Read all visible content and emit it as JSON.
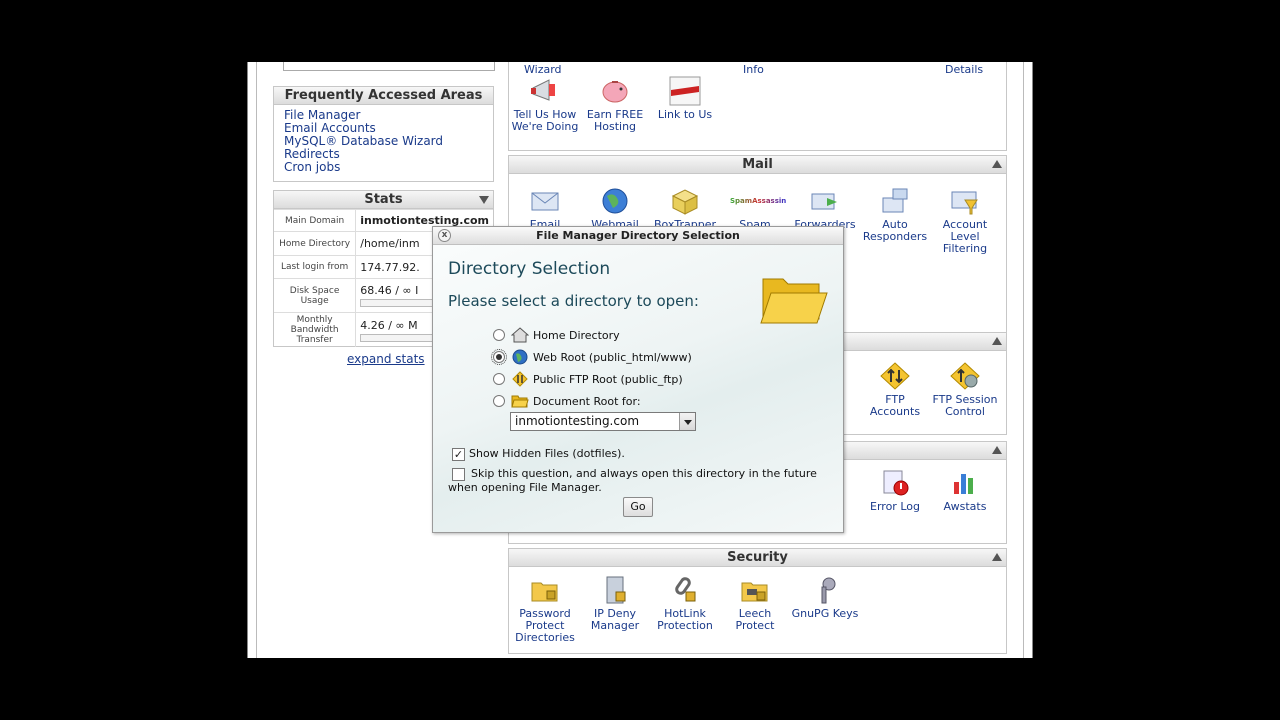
{
  "left": {
    "faa": {
      "title": "Frequently Accessed Areas",
      "links": [
        "File Manager",
        "Email Accounts",
        "MySQL® Database Wizard",
        "Redirects",
        "Cron jobs"
      ]
    },
    "stats": {
      "title": "Stats",
      "rows": [
        {
          "label": "Main Domain",
          "value": "inmotiontesting.com"
        },
        {
          "label": "Home Directory",
          "value": "/home/inm"
        },
        {
          "label": "Last login from",
          "value": "174.77.92."
        },
        {
          "label": "Disk Space Usage",
          "value": "68.46 / ∞ I"
        },
        {
          "label": "Monthly Bandwidth Transfer",
          "value": "4.26 / ∞ M"
        }
      ],
      "expand": "expand stats"
    }
  },
  "top_icons": [
    {
      "label": "Tell Us How We're Doing",
      "icon": "megaphone-icon"
    },
    {
      "label": "Earn FREE Hosting",
      "icon": "piggy-bank-icon"
    },
    {
      "label": "Link to Us",
      "icon": "link-banner-icon"
    }
  ],
  "top_cut": {
    "wizard": "Wizard",
    "info": "Info",
    "details": "Details"
  },
  "mail": {
    "title": "Mail",
    "items": [
      {
        "label": "Email",
        "icon": "envelope-icon"
      },
      {
        "label": "Webmail",
        "icon": "globe-mail-icon"
      },
      {
        "label": "BoxTrapper",
        "icon": "boxtrapper-icon"
      },
      {
        "label": "Spam",
        "icon": "spamassassin-icon"
      },
      {
        "label": "Forwarders",
        "icon": "forward-mail-icon"
      },
      {
        "label": "Auto Responders",
        "icon": "autoresponder-icon"
      },
      {
        "label": "Account Level Filtering",
        "icon": "filter-mail-icon"
      }
    ],
    "spam_logo": "SpamAssassin"
  },
  "files": {
    "items": [
      {
        "label": "FTP Accounts",
        "icon": "ftp-accounts-icon"
      },
      {
        "label": "FTP Session Control",
        "icon": "ftp-session-icon"
      }
    ]
  },
  "logs": {
    "items": [
      {
        "label": "Error Log",
        "icon": "error-log-icon"
      },
      {
        "label": "Awstats",
        "icon": "awstats-icon"
      }
    ]
  },
  "security": {
    "title": "Security",
    "items": [
      {
        "label": "Password Protect Directories",
        "icon": "password-folder-icon"
      },
      {
        "label": "IP Deny Manager",
        "icon": "ip-deny-icon"
      },
      {
        "label": "HotLink Protection",
        "icon": "hotlink-icon"
      },
      {
        "label": "Leech Protect",
        "icon": "leech-folder-icon"
      },
      {
        "label": "GnuPG Keys",
        "icon": "keys-icon"
      }
    ]
  },
  "dialog": {
    "window_title": "File Manager Directory Selection",
    "close": "x",
    "heading": "Directory Selection",
    "prompt": "Please select a directory to open:",
    "options": [
      {
        "label": "Home Directory",
        "icon": "home-icon",
        "selected": false
      },
      {
        "label": "Web Root (public_html/www)",
        "icon": "globe-icon",
        "selected": true
      },
      {
        "label": "Public FTP Root (public_ftp)",
        "icon": "ftp-arrows-icon",
        "selected": false
      },
      {
        "label": "Document Root for:",
        "icon": "open-folder-icon",
        "selected": false
      }
    ],
    "domain_select": "inmotiontesting.com",
    "show_hidden": {
      "label": "Show Hidden Files (dotfiles).",
      "checked": true
    },
    "skip": {
      "label": "Skip this question, and always open this directory in the future when opening File Manager.",
      "checked": false
    },
    "go": "Go"
  }
}
